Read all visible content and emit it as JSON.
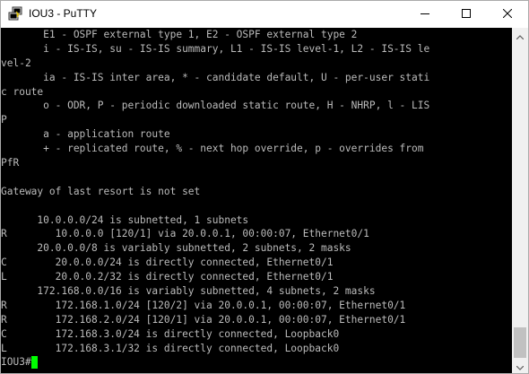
{
  "window": {
    "title": "IOU3 - PuTTY",
    "icons": {
      "app": "putty-app-icon",
      "minimize": "minimize-icon",
      "maximize": "maximize-icon",
      "close": "close-icon"
    }
  },
  "terminal": {
    "background": "#000000",
    "foreground": "#bbbbbb",
    "cursor_color": "#00ff00",
    "lines": [
      "       E1 - OSPF external type 1, E2 - OSPF external type 2",
      "       i - IS-IS, su - IS-IS summary, L1 - IS-IS level-1, L2 - IS-IS le",
      "vel-2",
      "       ia - IS-IS inter area, * - candidate default, U - per-user stati",
      "c route",
      "       o - ODR, P - periodic downloaded static route, H - NHRP, l - LIS",
      "P",
      "       a - application route",
      "       + - replicated route, % - next hop override, p - overrides from",
      "PfR",
      "",
      "Gateway of last resort is not set",
      "",
      "      10.0.0.0/24 is subnetted, 1 subnets",
      "R        10.0.0.0 [120/1] via 20.0.0.1, 00:00:07, Ethernet0/1",
      "      20.0.0.0/8 is variably subnetted, 2 subnets, 2 masks",
      "C        20.0.0.0/24 is directly connected, Ethernet0/1",
      "L        20.0.0.2/32 is directly connected, Ethernet0/1",
      "      172.168.0.0/16 is variably subnetted, 4 subnets, 2 masks",
      "R        172.168.1.0/24 [120/2] via 20.0.0.1, 00:00:07, Ethernet0/1",
      "R        172.168.2.0/24 [120/1] via 20.0.0.1, 00:00:07, Ethernet0/1",
      "C        172.168.3.0/24 is directly connected, Loopback0",
      "L        172.168.3.1/32 is directly connected, Loopback0"
    ],
    "prompt": "IOU3#"
  },
  "scrollbar": {
    "position": 1.0,
    "icons": {
      "up": "scroll-up-arrow-icon",
      "down": "scroll-down-arrow-icon"
    }
  }
}
